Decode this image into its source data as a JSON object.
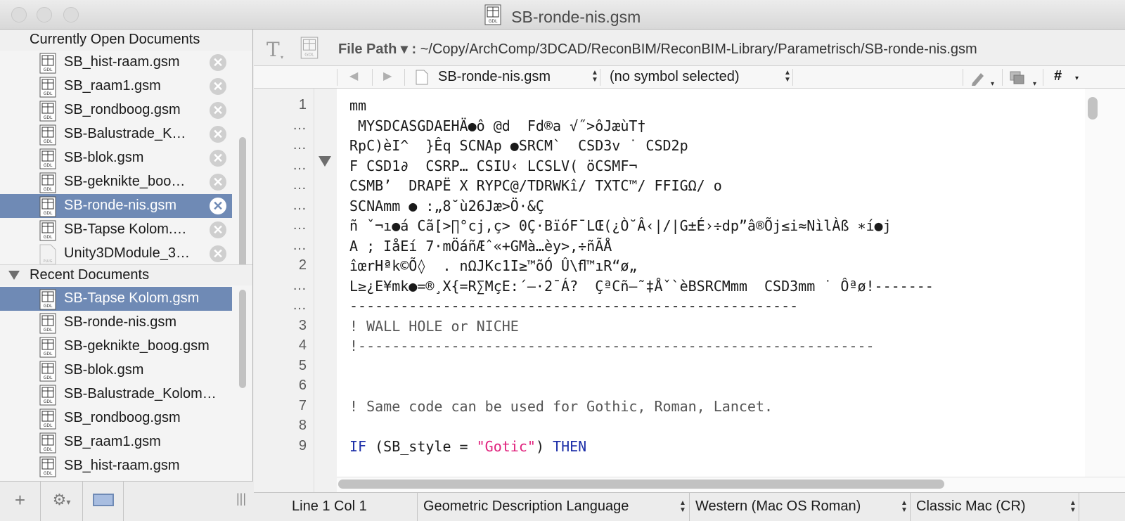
{
  "window": {
    "title": "SB-ronde-nis.gsm"
  },
  "sidebar": {
    "open_header": "Currently Open Documents",
    "recent_header": "Recent Documents",
    "open_docs": [
      {
        "label": "SB_hist-raam.gsm",
        "icon": "gdl-file-icon"
      },
      {
        "label": "SB_raam1.gsm",
        "icon": "gdl-file-icon"
      },
      {
        "label": "SB_rondboog.gsm",
        "icon": "gdl-file-icon"
      },
      {
        "label": "SB-Balustrade_K…",
        "icon": "gdl-file-icon"
      },
      {
        "label": "SB-blok.gsm",
        "icon": "gdl-file-icon"
      },
      {
        "label": "SB-geknikte_boo…",
        "icon": "gdl-file-icon"
      },
      {
        "label": "SB-ronde-nis.gsm",
        "icon": "gdl-file-icon",
        "selected": true
      },
      {
        "label": "SB-Tapse Kolom.…",
        "icon": "gdl-file-icon"
      },
      {
        "label": "Unity3DModule_3…",
        "icon": "plain-file-icon"
      }
    ],
    "recent_docs": [
      {
        "label": "SB-Tapse Kolom.gsm",
        "selected": true
      },
      {
        "label": "SB-ronde-nis.gsm"
      },
      {
        "label": "SB-geknikte_boog.gsm"
      },
      {
        "label": "SB-blok.gsm"
      },
      {
        "label": "SB-Balustrade_Kolom…"
      },
      {
        "label": "SB_rondboog.gsm"
      },
      {
        "label": "SB_raam1.gsm"
      },
      {
        "label": "SB_hist-raam.gsm"
      }
    ],
    "bottom": {
      "add": "+",
      "gear": "⚙",
      "grip": "|||"
    }
  },
  "toolbar": {
    "file_path_label": "File Path",
    "file_path_value": "~/Copy/ArchComp/3DCAD/ReconBIM/ReconBIM-Library/Parametrisch/SB-ronde-nis.gsm"
  },
  "navbar": {
    "file_select": "SB-ronde-nis.gsm",
    "symbol_select": "(no symbol selected)",
    "hash": "#"
  },
  "editor": {
    "line_numbers": [
      "1",
      "…",
      "…",
      "…",
      "…",
      "…",
      "…",
      "…",
      "2",
      "…",
      "…",
      "3",
      "4",
      "5",
      "6",
      "7",
      "8",
      "9"
    ],
    "lines": [
      "mm",
      " MYSDCASGDAEHÄ●ô @d  Fd®a √˝>ôJæùT†",
      "RpC)èI^  }Êq SCNAp ●SRCM`  CSD3v ˙ CSD2p",
      "F CSD1∂  CSRP… CSIU‹ LCSLV( öCSMF¬",
      "CSMB’  DRAPË X RYPC@/TDRWKî/ TXTC™/ FFIGΩ/ o",
      "SCNAmm ● :„8˘ù26Jæ>Ö·&Ç",
      "ñ ˇ¬ı●á Cã[>∏°cj,ç> 0Ç·BïóF¯LŒ(¿Ò˘Â‹|/|G±É›÷dp”â®Õj≤i≈NìlÀß ∗í●j",
      "A ; IåEí 7·mÖáñÆˆ«+GMà…èy>,÷ñÃÅ",
      "îœrHªk©Õ◊  . nΩJKc1I≥™õÓ Û\\ﬂ™ıR“ø„",
      "L≥¿E¥mk●=®¸X{=R∑MçE:´—·2¯Á?  ÇªCñ–˜‡Åˇ`èBSRCMmm  CSD3mm ˙ Ôªø!-------",
      "-----------------------------------------------------",
      "! WALL HOLE or NICHE",
      "!-------------------------------------------------------------",
      "",
      "",
      "! Same code can be used for Gothic, Roman, Lancet.",
      "",
      "IF (SB_style = \"Gotic\") THEN"
    ],
    "last_line": {
      "kw_if": "IF",
      "mid": " (SB_style = ",
      "str": "\"Gotic\"",
      "end": ") ",
      "kw_then": "THEN"
    }
  },
  "status": {
    "position": "Line 1 Col 1",
    "language": "Geometric Description Language",
    "encoding": "Western (Mac OS Roman)",
    "line_endings": "Classic Mac (CR)"
  },
  "colors": {
    "selection": "#6f8ab5",
    "keyword": "#1c2ea8",
    "string": "#e0207c"
  }
}
